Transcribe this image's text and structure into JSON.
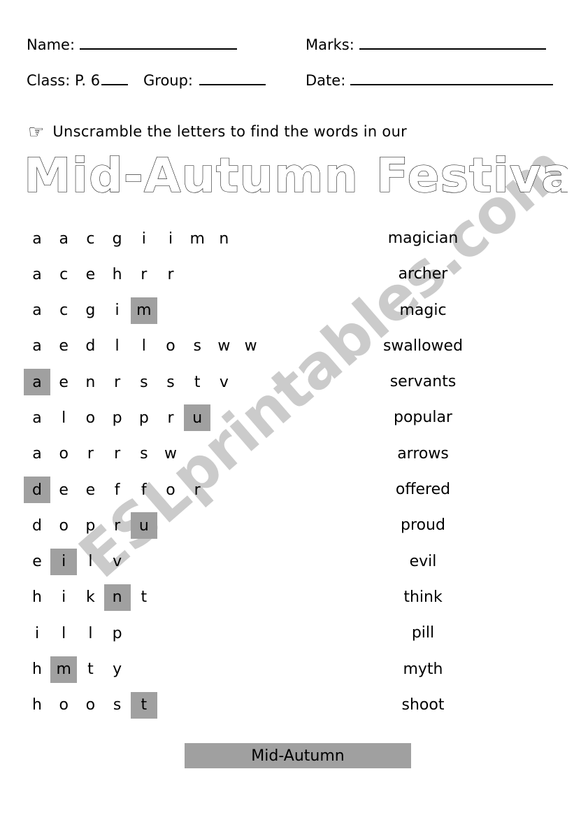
{
  "header": {
    "name_label": "Name:",
    "marks_label": "Marks:",
    "class_label": "Class: P. 6",
    "group_label": "Group:",
    "date_label": "Date:"
  },
  "instruction": {
    "icon": "pointing-hand-icon",
    "text": "Unscramble the letters to find the words in our"
  },
  "title": "Mid-Autumn Festival",
  "watermark": "ESLprintables.com",
  "colors": {
    "highlight": "#a0a0a0",
    "text": "#000000",
    "watermark": "#c9c9c9",
    "page": "#ffffff"
  },
  "puzzle": {
    "rows": [
      {
        "letters": [
          "a",
          "a",
          "c",
          "g",
          "i",
          "i",
          "m",
          "n"
        ],
        "highlight": -1,
        "answer": "magician"
      },
      {
        "letters": [
          "a",
          "c",
          "e",
          "h",
          "r",
          "r"
        ],
        "highlight": -1,
        "answer": "archer"
      },
      {
        "letters": [
          "a",
          "c",
          "g",
          "i",
          "m"
        ],
        "highlight": 4,
        "answer": "magic"
      },
      {
        "letters": [
          "a",
          "e",
          "d",
          "l",
          "l",
          "o",
          "s",
          "w",
          "w"
        ],
        "highlight": -1,
        "answer": "swallowed"
      },
      {
        "letters": [
          "a",
          "e",
          "n",
          "r",
          "s",
          "s",
          "t",
          "v"
        ],
        "highlight": 0,
        "answer": "servants"
      },
      {
        "letters": [
          "a",
          "l",
          "o",
          "p",
          "p",
          "r",
          "u"
        ],
        "highlight": 6,
        "answer": "popular"
      },
      {
        "letters": [
          "a",
          "o",
          "r",
          "r",
          "s",
          "w"
        ],
        "highlight": -1,
        "answer": "arrows"
      },
      {
        "letters": [
          "d",
          "e",
          "e",
          "f",
          "f",
          "o",
          "r"
        ],
        "highlight": 0,
        "answer": "offered"
      },
      {
        "letters": [
          "d",
          "o",
          "p",
          "r",
          "u"
        ],
        "highlight": 4,
        "answer": "proud"
      },
      {
        "letters": [
          "e",
          "i",
          "l",
          "v"
        ],
        "highlight": 1,
        "answer": "evil"
      },
      {
        "letters": [
          "h",
          "i",
          "k",
          "n",
          "t"
        ],
        "highlight": 3,
        "answer": "think"
      },
      {
        "letters": [
          "i",
          "l",
          "l",
          "p"
        ],
        "highlight": -1,
        "answer": "pill"
      },
      {
        "letters": [
          "h",
          "m",
          "t",
          "y"
        ],
        "highlight": 1,
        "answer": "myth"
      },
      {
        "letters": [
          "h",
          "o",
          "o",
          "s",
          "t"
        ],
        "highlight": 4,
        "answer": "shoot"
      }
    ]
  },
  "answer_bar": {
    "text": "Mid-Autumn"
  }
}
